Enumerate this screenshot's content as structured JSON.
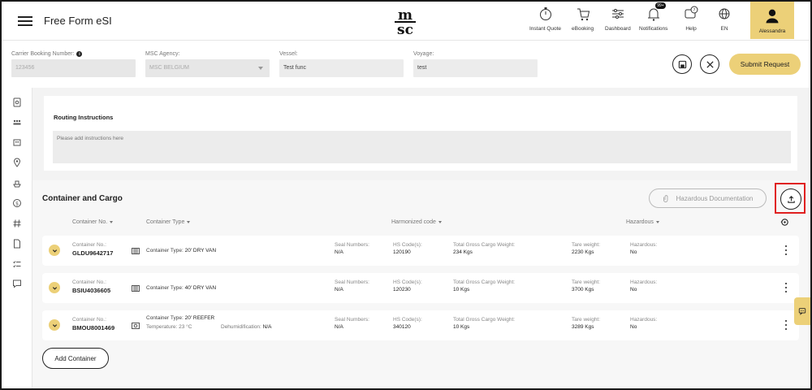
{
  "app": {
    "title": "Free Form eSI"
  },
  "nav": {
    "instant_quote": "Instant Quote",
    "ebooking": "eBooking",
    "dashboard": "Dashboard",
    "notifications": "Notifications",
    "notifications_badge": "99+",
    "help": "Help",
    "language": "EN",
    "user": "Alessandra"
  },
  "booking": {
    "carrier_booking_label": "Carrier Booking Number:",
    "carrier_booking_value": "123456",
    "agency_label": "MSC Agency:",
    "agency_value": "MSC BELGIUM",
    "vessel_label": "Vessel:",
    "vessel_value": "Test func",
    "voyage_label": "Voyage:",
    "voyage_value": "test",
    "submit_label": "Submit Request"
  },
  "routing": {
    "title": "Routing Instructions",
    "placeholder": "Please add instructions here"
  },
  "cargo": {
    "title": "Container and Cargo",
    "hazardous_doc_label": "Hazardous Documentation",
    "add_container_label": "Add Container",
    "columns": {
      "container_no": "Container No.",
      "container_type": "Container Type",
      "harmonized": "Harmonized code",
      "hazardous": "Hazardous"
    },
    "labels": {
      "container_no": "Container No.:",
      "container_type": "Container Type:",
      "seal": "Seal Numbers:",
      "hs": "HS Code(s):",
      "weight": "Total Gross Cargo Weight:",
      "tare": "Tare weight:",
      "hazardous": "Hazardous:",
      "temperature": "Temperature:",
      "dehumid": "Dehumidification:"
    },
    "rows": [
      {
        "container_no": "GLDU9642717",
        "type": "20' DRY VAN",
        "seal": "N/A",
        "hs": "120190",
        "weight": "234 Kgs",
        "tare": "2230 Kgs",
        "hazardous": "No"
      },
      {
        "container_no": "BSIU4036605",
        "type": "40' DRY VAN",
        "seal": "N/A",
        "hs": "120230",
        "weight": "10 Kgs",
        "tare": "3700 Kgs",
        "hazardous": "No"
      },
      {
        "container_no": "BMOU8001469",
        "type": "20' REEFER",
        "temperature": "23 °C",
        "dehumid": "N/A",
        "seal": "N/A",
        "hs": "340120",
        "weight": "10 Kgs",
        "tare": "3289 Kgs",
        "hazardous": "No"
      }
    ]
  },
  "colors": {
    "accent": "#ecd078",
    "highlight": "#e02020",
    "background": "#f3f3f3"
  }
}
